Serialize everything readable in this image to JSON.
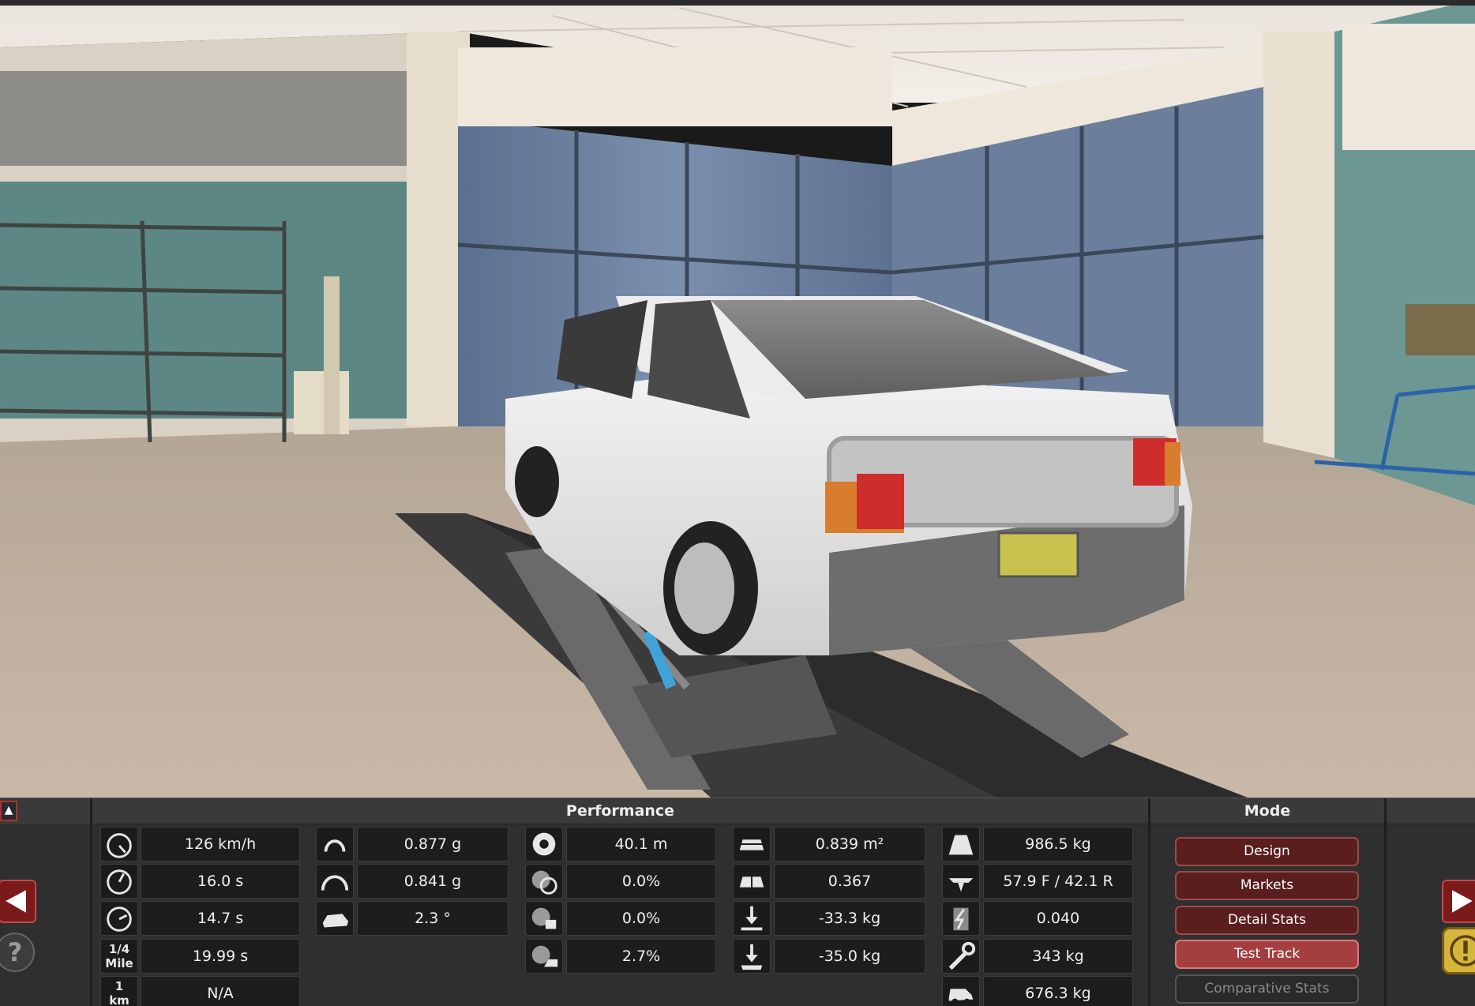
{
  "panel": {
    "performance_title": "Performance",
    "mode_title": "Mode"
  },
  "stats": {
    "col1": [
      {
        "icon": "speedometer-low-icon",
        "value": "126 km/h"
      },
      {
        "icon": "acceleration-0-100-icon",
        "value": "16.0 s"
      },
      {
        "icon": "acceleration-80-120-icon",
        "value": "14.7 s"
      },
      {
        "icon_text": "1/4\nMile",
        "value": "19.99 s"
      },
      {
        "icon_text": "1\nkm",
        "value": "N/A"
      }
    ],
    "col2": [
      {
        "icon": "cornering-g-icon",
        "value": "0.877 g"
      },
      {
        "icon": "cornering-g-large-icon",
        "value": "0.841 g"
      },
      {
        "icon": "body-roll-icon",
        "value": "2.3 °"
      }
    ],
    "col3": [
      {
        "icon": "braking-distance-icon",
        "value": "40.1 m"
      },
      {
        "icon": "understeer-icon",
        "value": "0.0%"
      },
      {
        "icon": "brake-fade-icon",
        "value": "0.0%"
      },
      {
        "icon": "wheel-drive-icon",
        "value": "2.7%"
      }
    ],
    "col4": [
      {
        "icon": "frontal-area-icon",
        "value": "0.839 m²"
      },
      {
        "icon": "drag-coefficient-icon",
        "value": "0.367"
      },
      {
        "icon": "front-downforce-icon",
        "value": "-33.3 kg"
      },
      {
        "icon": "rear-downforce-icon",
        "value": "-35.0 kg"
      }
    ],
    "col5": [
      {
        "icon": "weight-icon",
        "value": "986.5 kg"
      },
      {
        "icon": "weight-distribution-icon",
        "value": "57.9 F / 42.1 R"
      },
      {
        "icon": "tech-pool-icon",
        "value": "0.040"
      },
      {
        "icon": "service-cost-icon",
        "value": "343 kg"
      },
      {
        "icon": "towing-capacity-icon",
        "value": "676.3 kg"
      }
    ]
  },
  "mode": {
    "buttons": [
      "Design",
      "Markets",
      "Detail Stats",
      "Test Track",
      "Comparative Stats"
    ],
    "active": "Test Track",
    "disabled": "Comparative Stats"
  },
  "help_label": "?",
  "colors": {
    "accent_red": "#a53e3e",
    "panel_bg": "#2f2f2f",
    "cell_bg": "#1d1d1d",
    "warning_yellow": "#d6b53c"
  }
}
